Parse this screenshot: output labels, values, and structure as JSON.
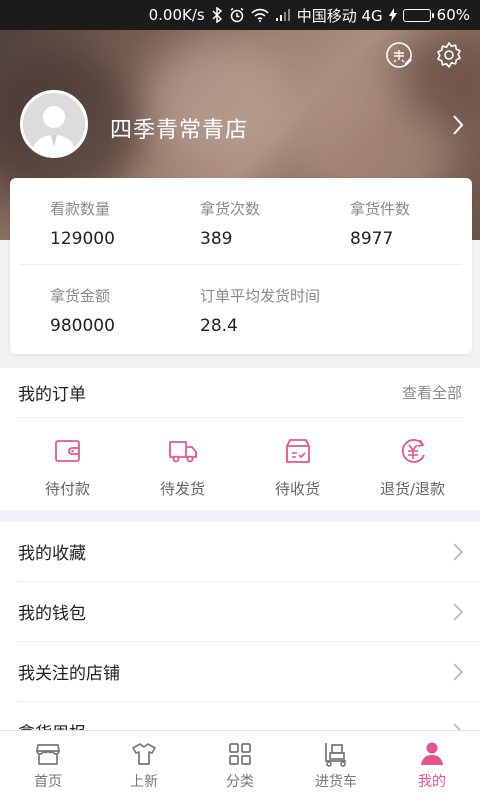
{
  "status_bar": {
    "speed": "0.00K/s",
    "carrier": "中国移动 4G",
    "battery": "60%",
    "battery_level": 0.6
  },
  "header": {
    "shop_name": "四季青常青店",
    "sign_icon": "sign-in-icon",
    "settings_icon": "gear-icon"
  },
  "stats": [
    {
      "label": "看款数量",
      "value": "129000"
    },
    {
      "label": "拿货次数",
      "value": "389"
    },
    {
      "label": "拿货件数",
      "value": "8977"
    },
    {
      "label": "拿货金额",
      "value": "980000"
    },
    {
      "label": "订单平均发货时间",
      "value": "28.4"
    }
  ],
  "orders": {
    "title": "我的订单",
    "view_all": "查看全部",
    "items": [
      {
        "label": "待付款",
        "icon": "wallet-icon"
      },
      {
        "label": "待发货",
        "icon": "truck-icon"
      },
      {
        "label": "待收货",
        "icon": "box-icon"
      },
      {
        "label": "退货/退款",
        "icon": "refund-icon"
      }
    ]
  },
  "menu": [
    {
      "label": "我的收藏"
    },
    {
      "label": "我的钱包"
    },
    {
      "label": "我关注的店铺"
    },
    {
      "label": "拿货周报"
    }
  ],
  "tabs": [
    {
      "label": "首页",
      "icon": "shop-icon"
    },
    {
      "label": "上新",
      "icon": "shirt-icon"
    },
    {
      "label": "分类",
      "icon": "grid-icon"
    },
    {
      "label": "进货车",
      "icon": "cart-icon"
    },
    {
      "label": "我的",
      "icon": "person-icon"
    }
  ],
  "colors": {
    "accent": "#e8558d",
    "text": "#222222",
    "muted": "#8a8a8a"
  }
}
